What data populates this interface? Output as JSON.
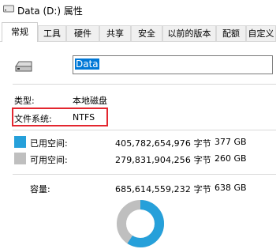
{
  "window": {
    "title": "Data (D:) 属性",
    "icon": "drive-icon"
  },
  "tabs": [
    "常规",
    "工具",
    "硬件",
    "共享",
    "安全",
    "以前的版本",
    "配额",
    "自定义"
  ],
  "active_tab": "常规",
  "drive": {
    "name": "Data"
  },
  "info": {
    "type_label": "类型:",
    "type_value": "本地磁盘",
    "fs_label": "文件系统:",
    "fs_value": "NTFS"
  },
  "capacity": {
    "used": {
      "label": "已用空间:",
      "bytes": "405,782,654,976 字节",
      "size": "377 GB",
      "color": "#26a0da"
    },
    "free": {
      "label": "可用空间:",
      "bytes": "279,831,904,256 字节",
      "size": "260 GB",
      "color": "#bfbfbf"
    },
    "total": {
      "label": "容量:",
      "bytes": "685,614,559,232 字节",
      "size": "638 GB"
    },
    "used_fraction": 0.592
  },
  "colors": {
    "highlight_box": "#e3262f",
    "selection": "#0078d7"
  }
}
